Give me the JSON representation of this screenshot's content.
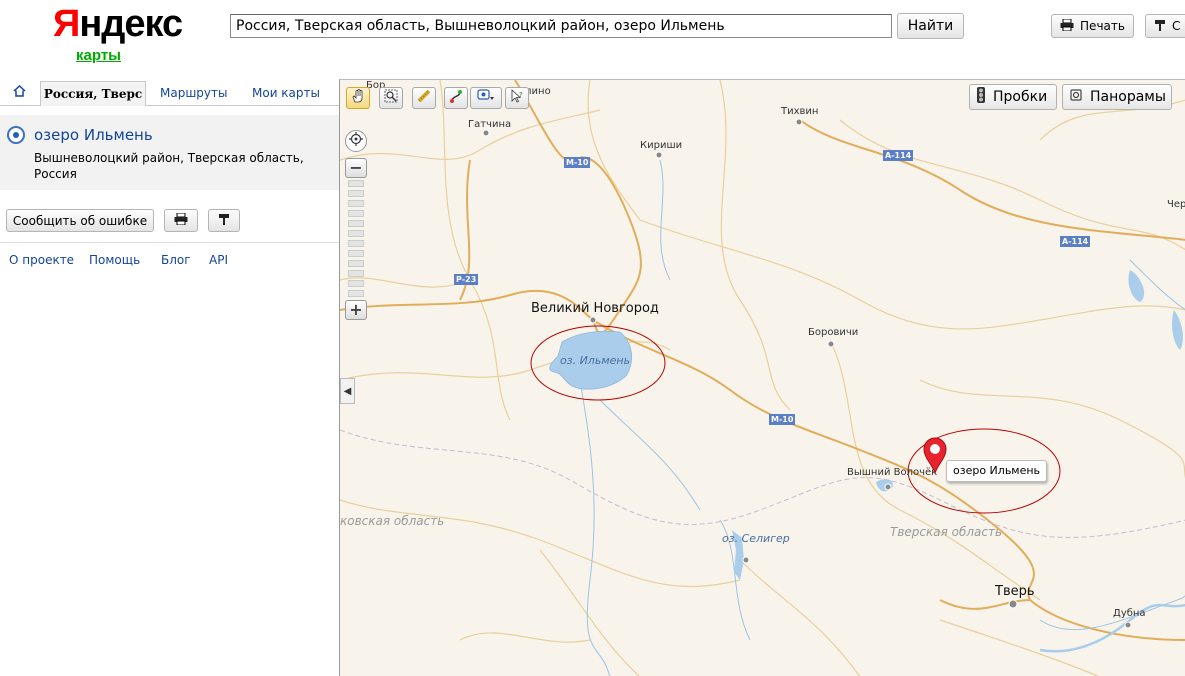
{
  "header": {
    "logo_first": "Я",
    "logo_rest": "ндекс",
    "logo_sub": "карты",
    "search_value": "Россия, Тверская область, Вышневолоцкий район, озеро Ильмень",
    "search_button": "Найти",
    "print_label": "Печать",
    "link_label": "С"
  },
  "sidebar": {
    "tabs": [
      "Россия, Тверс",
      "Маршруты",
      "Мои карты"
    ],
    "result": {
      "title": "озеро Ильмень",
      "address": "Вышневолоцкий район, Тверская область, Россия"
    },
    "report_button": "Сообщить об ошибке",
    "footer_links": [
      "О проекте",
      "Помощь",
      "Блог",
      "API"
    ]
  },
  "map": {
    "layer_buttons": [
      "Пробки",
      "Панорамы"
    ],
    "cities": [
      "Гатчина",
      "Кириши",
      "Тихвин",
      "Великий Новгород",
      "Боровичи",
      "Вышний Волочёк",
      "Тверь",
      "Дубна",
      "Бор",
      "пино",
      "Чер"
    ],
    "water": [
      "оз. Ильмень",
      "оз. Селигер"
    ],
    "regions": [
      "Тверская область",
      "ковская область"
    ],
    "roads": [
      "М-10",
      "М-10",
      "А-114",
      "А-114",
      "Р-23"
    ],
    "balloon": "озеро Ильмень"
  }
}
